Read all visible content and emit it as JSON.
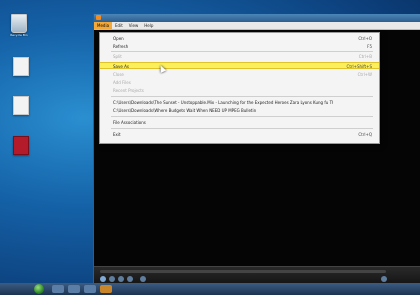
{
  "desktop": {
    "icons": [
      {
        "name": "Recycle Bin",
        "label": "Recycle Bin"
      },
      {
        "name": "document",
        "label": ""
      },
      {
        "name": "document",
        "label": ""
      },
      {
        "name": "pdf",
        "label": ""
      }
    ]
  },
  "player": {
    "menubar": [
      "Media",
      "Edit",
      "View",
      "Help"
    ],
    "menu": {
      "items": [
        {
          "label": "Open",
          "shortcut": "Ctrl+O",
          "state": "normal"
        },
        {
          "label": "Refresh",
          "shortcut": "F5",
          "state": "normal"
        },
        {
          "label": "Split",
          "shortcut": "Ctrl+B",
          "state": "disabled"
        },
        {
          "label": "Save As",
          "shortcut": "Ctrl+Shift+S",
          "state": "highlighted"
        },
        {
          "label": "Close",
          "shortcut": "Ctrl+W",
          "state": "disabled"
        },
        {
          "label": "Add Files",
          "shortcut": "",
          "state": "disabled"
        },
        {
          "label": "Recent Projects",
          "shortcut": "",
          "state": "disabled"
        },
        {
          "label": "C:\\Users\\Downloads\\The Sunset - Unstoppable.Mix - Launching for the Expected Heroes Zara Lyons Kung fu The Sobering (mp4)",
          "shortcut": "",
          "state": "normal"
        },
        {
          "label": "C:\\Users\\Downloads\\Where Budgets Wait When NEED UP MPEG Bulletin",
          "shortcut": "",
          "state": "normal"
        },
        {
          "label": "File Associations",
          "shortcut": "",
          "state": "normal"
        },
        {
          "label": "Exit",
          "shortcut": "Ctrl+Q",
          "state": "normal"
        }
      ]
    }
  },
  "colors": {
    "highlight": "#fbf05c",
    "menu_active": "#f3a93a",
    "desktop": "#1562a8"
  }
}
